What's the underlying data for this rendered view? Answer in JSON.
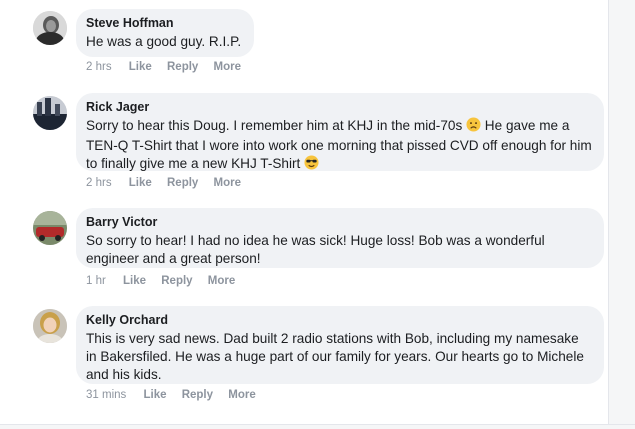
{
  "comments": [
    {
      "author": "Steve Hoffman",
      "text": "He was a good guy. R.I.P.",
      "time": "2 hrs",
      "actions": {
        "like": "Like",
        "reply": "Reply",
        "more": "More"
      }
    },
    {
      "author": "Rick Jager",
      "text_part1": "Sorry to hear this Doug. I remember him at KHJ in the mid-70s",
      "text_part2": " He gave me a TEN-Q T-Shirt that I wore into work one morning that pissed CVD off enough for him to finally give me a new KHJ T-Shirt",
      "time": "2 hrs",
      "emoji_sad": "sad-face-emoji",
      "emoji_cool": "sunglasses-emoji",
      "actions": {
        "like": "Like",
        "reply": "Reply",
        "more": "More"
      }
    },
    {
      "author": "Barry Victor",
      "text": "So sorry to hear! I had no idea he was sick! Huge loss! Bob was a wonderful engineer and a great person!",
      "time": "1 hr",
      "actions": {
        "like": "Like",
        "reply": "Reply",
        "more": "More"
      }
    },
    {
      "author": "Kelly Orchard",
      "text": "This is very sad news. Dad built 2 radio stations with Bob, including my namesake in Bakersfiled. He was a huge part of our family for years. Our hearts go to Michele and his kids.",
      "time": "31 mins",
      "actions": {
        "like": "Like",
        "reply": "Reply",
        "more": "More"
      }
    }
  ]
}
